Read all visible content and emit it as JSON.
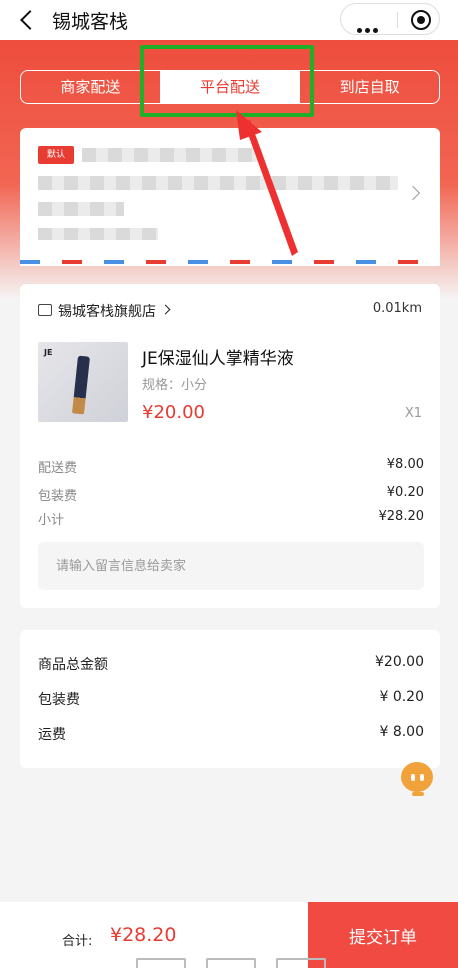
{
  "header": {
    "title": "锡城客栈"
  },
  "tabs": [
    {
      "label": "商家配送"
    },
    {
      "label": "平台配送"
    },
    {
      "label": "到店自取"
    }
  ],
  "address": {
    "badge": "默认"
  },
  "store": {
    "name": "锡城客栈旗舰店",
    "distance": "0.01km"
  },
  "product": {
    "name": "JE保湿仙人掌精华液",
    "spec": "规格：小分",
    "price": "¥20.00",
    "qty": "X1",
    "logo": "JE"
  },
  "fees": [
    {
      "label": "配送费",
      "value": "¥8.00"
    },
    {
      "label": "包装费",
      "value": "¥0.20"
    },
    {
      "label": "小计",
      "value": "¥28.20"
    }
  ],
  "note": {
    "placeholder": "请输入留言信息给卖家"
  },
  "summary": [
    {
      "label": "商品总金额",
      "value": "¥20.00"
    },
    {
      "label": "包装费",
      "value": "¥ 0.20"
    },
    {
      "label": "运费",
      "value": "¥ 8.00"
    }
  ],
  "footer": {
    "total_label": "合计:",
    "total_value": "¥28.20",
    "submit_label": "提交订单"
  },
  "colors": {
    "brand_red": "#e83b32",
    "highlight_green": "#1fb028",
    "service_orange": "#f2a23a"
  }
}
